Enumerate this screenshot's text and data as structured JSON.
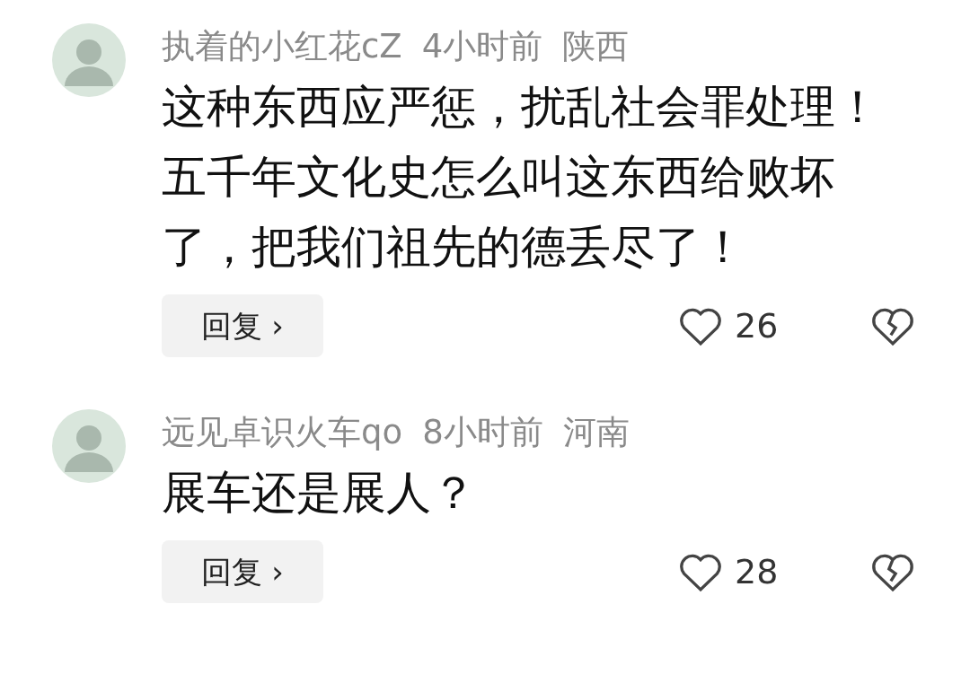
{
  "comments": [
    {
      "username": "执着的小红花cZ",
      "time": "4小时前",
      "location": "陕西",
      "text": "这种东西应严惩，扰乱社会罪处理！五千年文化史怎么叫这东西给败坏了，把我们祖先的德丢尽了！",
      "reply_label": "回复",
      "reply_arrow": "›",
      "likes": "26"
    },
    {
      "username": "远见卓识火车qo",
      "time": "8小时前",
      "location": "河南",
      "text": "展车还是展人？",
      "reply_label": "回复",
      "reply_arrow": "›",
      "likes": "28"
    }
  ]
}
